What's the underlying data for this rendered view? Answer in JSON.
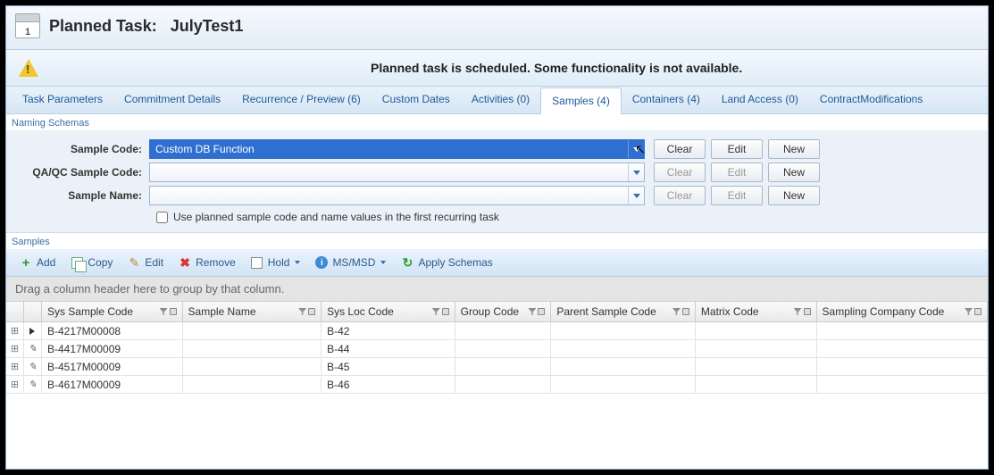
{
  "header": {
    "title_prefix": "Planned Task:",
    "title_name": "JulyTest1",
    "calendar_day": "1"
  },
  "warning": {
    "text": "Planned task is scheduled. Some functionality is not available."
  },
  "tabs": [
    {
      "label": "Task Parameters"
    },
    {
      "label": "Commitment Details"
    },
    {
      "label": "Recurrence / Preview (6)"
    },
    {
      "label": "Custom Dates"
    },
    {
      "label": "Activities (0)"
    },
    {
      "label": "Samples (4)",
      "active": true
    },
    {
      "label": "Containers (4)"
    },
    {
      "label": "Land Access (0)"
    },
    {
      "label": "ContractModifications"
    }
  ],
  "naming_section": {
    "title": "Naming Schemas",
    "rows": {
      "sample_code": {
        "label": "Sample Code:",
        "value": "Custom DB Function",
        "clear": "Clear",
        "edit": "Edit",
        "new": "New",
        "clear_enabled": true,
        "edit_enabled": true
      },
      "qaqc": {
        "label": "QA/QC Sample Code:",
        "value": "",
        "clear": "Clear",
        "edit": "Edit",
        "new": "New",
        "clear_enabled": false,
        "edit_enabled": false
      },
      "sample_name": {
        "label": "Sample Name:",
        "value": "",
        "clear": "Clear",
        "edit": "Edit",
        "new": "New",
        "clear_enabled": false,
        "edit_enabled": false
      }
    },
    "checkbox_label": "Use planned sample code and name values in the first recurring task"
  },
  "samples_section": {
    "title": "Samples",
    "toolbar": {
      "add": "Add",
      "copy": "Copy",
      "edit": "Edit",
      "remove": "Remove",
      "hold": "Hold",
      "msmsd": "MS/MSD",
      "apply": "Apply Schemas"
    },
    "group_hint": "Drag a column header here to group by that column.",
    "columns": [
      "Sys Sample Code",
      "Sample Name",
      "Sys Loc Code",
      "Group Code",
      "Parent Sample Code",
      "Matrix Code",
      "Sampling Company Code"
    ],
    "rows": [
      {
        "marker": "pointer",
        "sys_sample_code": "B-4217M00008",
        "sample_name": "",
        "sys_loc_code": "B-42",
        "group_code": "",
        "parent": "",
        "matrix": "",
        "company": ""
      },
      {
        "marker": "pencil",
        "sys_sample_code": "B-4417M00009",
        "sample_name": "",
        "sys_loc_code": "B-44",
        "group_code": "",
        "parent": "",
        "matrix": "",
        "company": ""
      },
      {
        "marker": "pencil",
        "sys_sample_code": "B-4517M00009",
        "sample_name": "",
        "sys_loc_code": "B-45",
        "group_code": "",
        "parent": "",
        "matrix": "",
        "company": ""
      },
      {
        "marker": "pencil",
        "sys_sample_code": "B-4617M00009",
        "sample_name": "",
        "sys_loc_code": "B-46",
        "group_code": "",
        "parent": "",
        "matrix": "",
        "company": ""
      }
    ]
  }
}
